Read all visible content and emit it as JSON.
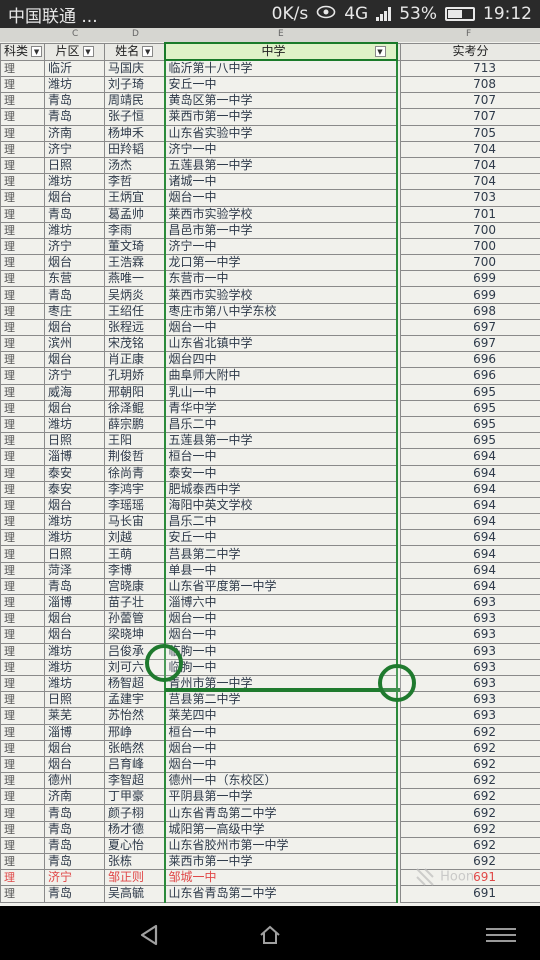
{
  "status": {
    "carrier": "中国联通 ...",
    "speed": "0K/s",
    "network": "4G",
    "battery": "53%",
    "battery_level": 0.53,
    "time": "19:12"
  },
  "sheet": {
    "column_letters": [
      "C",
      "D",
      "E",
      "F"
    ],
    "headers": {
      "type": "科类",
      "area": "片区",
      "name": "姓名",
      "school": "中学",
      "score": "实考分"
    },
    "rows": [
      {
        "type": "理",
        "area": "临沂",
        "name": "马国庆",
        "school": "临沂第十八中学",
        "score": "713"
      },
      {
        "type": "理",
        "area": "潍坊",
        "name": "刘子琦",
        "school": "安丘一中",
        "score": "708"
      },
      {
        "type": "理",
        "area": "青岛",
        "name": "周靖民",
        "school": "黄岛区第一中学",
        "score": "707"
      },
      {
        "type": "理",
        "area": "青岛",
        "name": "张子恒",
        "school": "莱西市第一中学",
        "score": "707"
      },
      {
        "type": "理",
        "area": "济南",
        "name": "杨坤禾",
        "school": "山东省实验中学",
        "score": "705"
      },
      {
        "type": "理",
        "area": "济宁",
        "name": "田羚韬",
        "school": "济宁一中",
        "score": "704"
      },
      {
        "type": "理",
        "area": "日照",
        "name": "汤杰",
        "school": "五莲县第一中学",
        "score": "704"
      },
      {
        "type": "理",
        "area": "潍坊",
        "name": "李哲",
        "school": "诸城一中",
        "score": "704"
      },
      {
        "type": "理",
        "area": "烟台",
        "name": "王炳宜",
        "school": "烟台一中",
        "score": "703"
      },
      {
        "type": "理",
        "area": "青岛",
        "name": "葛孟帅",
        "school": "莱西市实验学校",
        "score": "701"
      },
      {
        "type": "理",
        "area": "潍坊",
        "name": "李雨",
        "school": "昌邑市第一中学",
        "score": "700"
      },
      {
        "type": "理",
        "area": "济宁",
        "name": "董文琦",
        "school": "济宁一中",
        "score": "700"
      },
      {
        "type": "理",
        "area": "烟台",
        "name": "王浩霖",
        "school": "龙口第一中学",
        "score": "700"
      },
      {
        "type": "理",
        "area": "东营",
        "name": "燕唯一",
        "school": "东营市一中",
        "score": "699"
      },
      {
        "type": "理",
        "area": "青岛",
        "name": "吴炳炎",
        "school": "莱西市实验学校",
        "score": "699"
      },
      {
        "type": "理",
        "area": "枣庄",
        "name": "王绍任",
        "school": "枣庄市第八中学东校",
        "score": "698"
      },
      {
        "type": "理",
        "area": "烟台",
        "name": "张程远",
        "school": "烟台一中",
        "score": "697"
      },
      {
        "type": "理",
        "area": "滨州",
        "name": "宋茂铭",
        "school": "山东省北镇中学",
        "score": "697"
      },
      {
        "type": "理",
        "area": "烟台",
        "name": "肖正康",
        "school": "烟台四中",
        "score": "696"
      },
      {
        "type": "理",
        "area": "济宁",
        "name": "孔玥娇",
        "school": "曲阜师大附中",
        "score": "696"
      },
      {
        "type": "理",
        "area": "威海",
        "name": "邢朝阳",
        "school": "乳山一中",
        "score": "695"
      },
      {
        "type": "理",
        "area": "烟台",
        "name": "徐泽鲲",
        "school": "青华中学",
        "score": "695"
      },
      {
        "type": "理",
        "area": "潍坊",
        "name": "薛宗鹏",
        "school": "昌乐二中",
        "score": "695"
      },
      {
        "type": "理",
        "area": "日照",
        "name": "王阳",
        "school": "五莲县第一中学",
        "score": "695"
      },
      {
        "type": "理",
        "area": "淄博",
        "name": "荆俊哲",
        "school": "桓台一中",
        "score": "694"
      },
      {
        "type": "理",
        "area": "泰安",
        "name": "徐尚青",
        "school": "泰安一中",
        "score": "694"
      },
      {
        "type": "理",
        "area": "泰安",
        "name": "李鸿宇",
        "school": "肥城泰西中学",
        "score": "694"
      },
      {
        "type": "理",
        "area": "烟台",
        "name": "李瑶瑶",
        "school": "海阳中英文学校",
        "score": "694"
      },
      {
        "type": "理",
        "area": "潍坊",
        "name": "马长宙",
        "school": "昌乐二中",
        "score": "694"
      },
      {
        "type": "理",
        "area": "潍坊",
        "name": "刘越",
        "school": "安丘一中",
        "score": "694"
      },
      {
        "type": "理",
        "area": "日照",
        "name": "王萌",
        "school": "莒县第二中学",
        "score": "694"
      },
      {
        "type": "理",
        "area": "菏泽",
        "name": "李博",
        "school": "单县一中",
        "score": "694"
      },
      {
        "type": "理",
        "area": "青岛",
        "name": "宫晓康",
        "school": "山东省平度第一中学",
        "score": "694"
      },
      {
        "type": "理",
        "area": "淄博",
        "name": "苗子壮",
        "school": "淄博六中",
        "score": "693"
      },
      {
        "type": "理",
        "area": "烟台",
        "name": "孙蕾管",
        "school": "烟台一中",
        "score": "693"
      },
      {
        "type": "理",
        "area": "烟台",
        "name": "梁晓坤",
        "school": "烟台一中",
        "score": "693"
      },
      {
        "type": "理",
        "area": "潍坊",
        "name": "吕俊承",
        "school": "临朐一中",
        "score": "693"
      },
      {
        "type": "理",
        "area": "潍坊",
        "name": "刘可六",
        "school": "临朐一中",
        "score": "693"
      },
      {
        "type": "理",
        "area": "潍坊",
        "name": "杨智超",
        "school": "青州市第一中学",
        "score": "693"
      },
      {
        "type": "理",
        "area": "日照",
        "name": "孟建宇",
        "school": "莒县第二中学",
        "score": "693"
      },
      {
        "type": "理",
        "area": "莱芜",
        "name": "苏怡然",
        "school": "莱芜四中",
        "score": "693"
      },
      {
        "type": "理",
        "area": "淄博",
        "name": "邢峥",
        "school": "桓台一中",
        "score": "692"
      },
      {
        "type": "理",
        "area": "烟台",
        "name": "张皓然",
        "school": "烟台一中",
        "score": "692"
      },
      {
        "type": "理",
        "area": "烟台",
        "name": "吕育峰",
        "school": "烟台一中",
        "score": "692"
      },
      {
        "type": "理",
        "area": "德州",
        "name": "李智超",
        "school": "德州一中（东校区）",
        "score": "692"
      },
      {
        "type": "理",
        "area": "济南",
        "name": "丁甲豪",
        "school": "平阴县第一中学",
        "score": "692"
      },
      {
        "type": "理",
        "area": "青岛",
        "name": "颜子栩",
        "school": "山东省青岛第二中学",
        "score": "692"
      },
      {
        "type": "理",
        "area": "青岛",
        "name": "杨才德",
        "school": "城阳第一高级中学",
        "score": "692"
      },
      {
        "type": "理",
        "area": "青岛",
        "name": "夏心怡",
        "school": "山东省胶州市第一中学",
        "score": "692"
      },
      {
        "type": "理",
        "area": "青岛",
        "name": "张栋",
        "school": "莱西市第一中学",
        "score": "692"
      },
      {
        "type": "理",
        "area": "济宁",
        "name": "邹正则",
        "school": "邹城一中",
        "score": "691",
        "highlight": true
      },
      {
        "type": "理",
        "area": "青岛",
        "name": "吴高毓",
        "school": "山东省青岛第二中学",
        "score": "691"
      }
    ]
  },
  "watermark": "Hoon",
  "colors": {
    "selection": "#1f7a2e",
    "highlight_row": "#e04848"
  }
}
